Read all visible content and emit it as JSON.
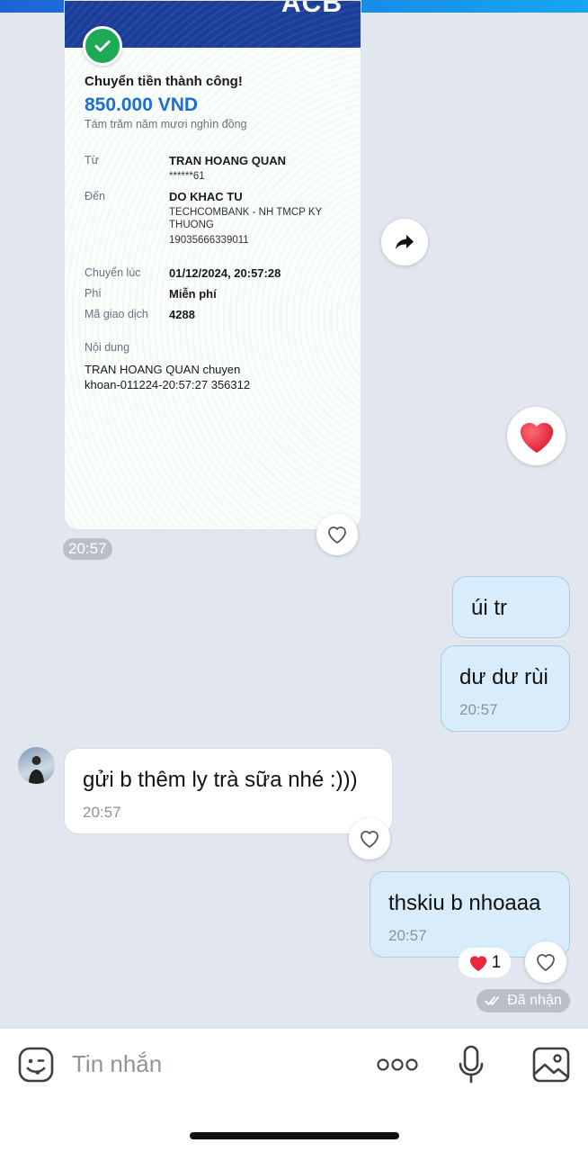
{
  "receipt": {
    "brand": "ACB",
    "title": "Chuyển tiền thành công!",
    "amount": "850.000 VND",
    "amount_words": "Tám trăm năm mươi nghìn đồng",
    "from_label": "Từ",
    "from_name": "TRAN HOANG QUAN",
    "from_account": "******61",
    "to_label": "Đến",
    "to_name": "DO KHAC TU",
    "to_bank_line1": "TECHCOMBANK - NH TMCP KY",
    "to_bank_line2": "THUONG",
    "to_account": "19035666339011",
    "time_label": "Chuyển lúc",
    "time_value": "01/12/2024, 20:57:28",
    "fee_label": "Phí",
    "fee_value": "Miễn phí",
    "code_label": "Mã giao dịch",
    "code_value": "4288",
    "note_label": "Nội dung",
    "note_line1": "TRAN HOANG QUAN chuyen",
    "note_line2": "khoan-011224-20:57:27 356312"
  },
  "receipt_time": "20:57",
  "messages": [
    {
      "side": "me",
      "text": "úi tr",
      "time": ""
    },
    {
      "side": "me",
      "text": "dư dư rùi",
      "time": "20:57"
    },
    {
      "side": "them",
      "text": "gửi b thêm ly trà sữa nhé :)))",
      "time": "20:57"
    },
    {
      "side": "me",
      "text": "thskiu b nhoaaa",
      "time": "20:57"
    }
  ],
  "reaction_count": "1",
  "status": "Đã nhận",
  "composer": {
    "placeholder": "Tin nhắn"
  },
  "colors": {
    "accent": "#1b6fd6",
    "heart": "#e8283c",
    "my_bubble": "#d8ecfb"
  }
}
